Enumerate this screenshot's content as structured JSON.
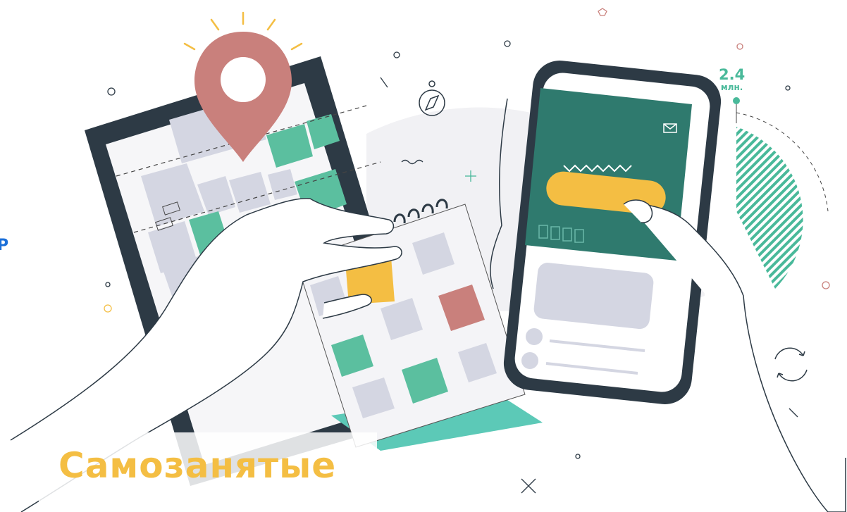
{
  "banner": {
    "title": "Самозанятые",
    "stat_value": "2.4",
    "stat_unit": "млн.",
    "edge_glyph": "Р"
  },
  "icons": [
    "map-pin-icon",
    "compass-icon",
    "mail-icon",
    "refresh-icon",
    "calendar-icon",
    "phone-icon"
  ],
  "colors": {
    "accent_yellow": "#f4be43",
    "accent_green": "#49b99a",
    "dark_teal": "#2f7a6e",
    "pin_rose": "#c9807c",
    "frame_dark": "#2d3a45",
    "block_grey": "#d4d6e2",
    "link_blue": "#1b6fd8"
  }
}
